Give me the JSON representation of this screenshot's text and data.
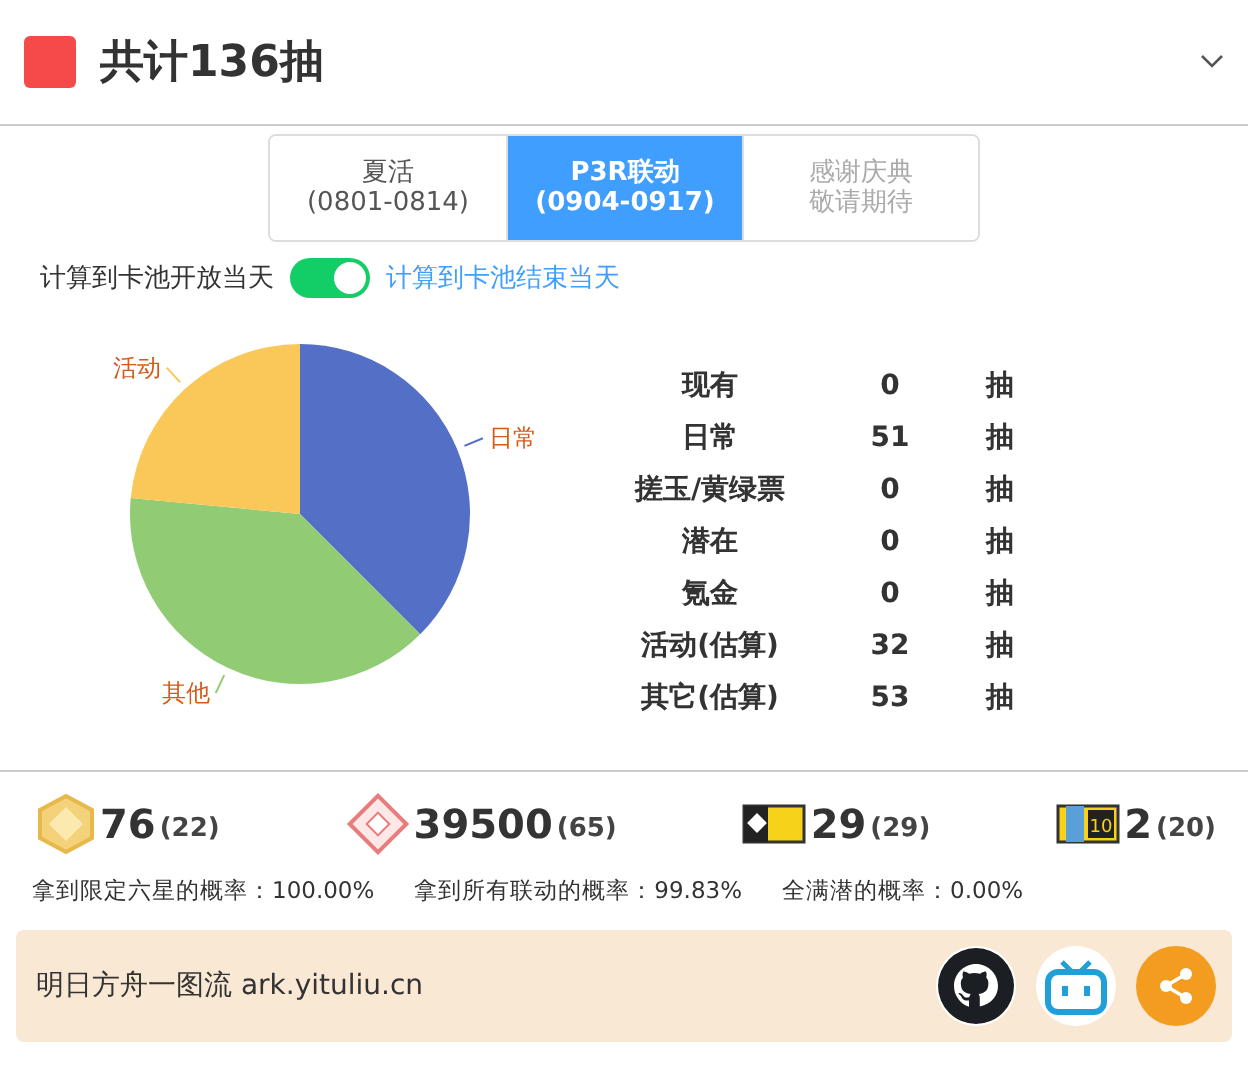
{
  "header": {
    "title": "共计136抽",
    "expanded": true
  },
  "tabs": [
    {
      "name": "夏活",
      "dates": "(0801-0814)",
      "selected": false,
      "disabled": false
    },
    {
      "name": "P3R联动",
      "dates": "(0904-0917)",
      "selected": true,
      "disabled": false
    },
    {
      "name": "感谢庆典",
      "dates": "敬请期待",
      "selected": false,
      "disabled": true
    }
  ],
  "toggle": {
    "off_label": "计算到卡池开放当天",
    "on_label": "计算到卡池结束当天",
    "on": true
  },
  "chart_data": {
    "type": "pie",
    "categories": [
      "日常",
      "其他",
      "活动"
    ],
    "values": [
      37.5,
      39,
      23.5
    ],
    "colors": [
      "#5470c6",
      "#91cc75",
      "#fac858"
    ]
  },
  "summary": [
    {
      "label": "现有",
      "value": "0",
      "unit": "抽"
    },
    {
      "label": "日常",
      "value": "51",
      "unit": "抽"
    },
    {
      "label": "搓玉/黄绿票",
      "value": "0",
      "unit": "抽"
    },
    {
      "label": "潜在",
      "value": "0",
      "unit": "抽"
    },
    {
      "label": "氪金",
      "value": "0",
      "unit": "抽"
    },
    {
      "label": "活动(估算)",
      "value": "32",
      "unit": "抽"
    },
    {
      "label": "其它(估算)",
      "value": "53",
      "unit": "抽"
    }
  ],
  "resources": [
    {
      "kind": "hexagon",
      "amount": "76",
      "draws": "(22)"
    },
    {
      "kind": "diamond",
      "amount": "39500",
      "draws": "(65)"
    },
    {
      "kind": "ticket",
      "amount": "29",
      "draws": "(29)"
    },
    {
      "kind": "ticket10",
      "amount": "2",
      "draws": "(20)",
      "badge": "10"
    }
  ],
  "probabilities": [
    "拿到限定六星的概率：100.00%",
    "拿到所有联动的概率：99.83%",
    "全满潜的概率：0.00%"
  ],
  "footer": {
    "site": "明日方舟一图流 ark.yituliu.cn"
  }
}
